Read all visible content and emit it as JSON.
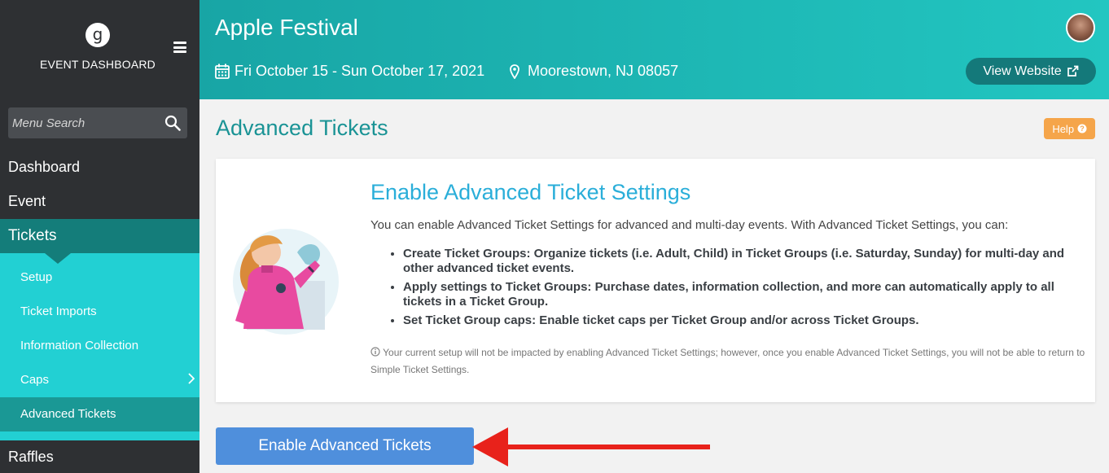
{
  "sidebar": {
    "logo_letter": "g",
    "brand_title": "EVENT DASHBOARD",
    "search_placeholder": "Menu Search",
    "nav": [
      "Dashboard",
      "Event"
    ],
    "section": "Tickets",
    "sub_items": [
      "Setup",
      "Ticket Imports",
      "Information Collection",
      "Caps",
      "Advanced Tickets"
    ],
    "active_sub": "Advanced Tickets",
    "after": "Raffles"
  },
  "header": {
    "event_name": "Apple Festival",
    "dates": "Fri October 15 - Sun October 17, 2021",
    "location": "Moorestown, NJ 08057",
    "view_website": "View Website"
  },
  "main": {
    "page_title": "Advanced Tickets",
    "help_label": "Help",
    "card": {
      "title": "Enable Advanced Ticket Settings",
      "intro": "You can enable Advanced Ticket Settings for advanced and multi-day events. With Advanced Ticket Settings, you can:",
      "bullets": [
        "Create Ticket Groups: Organize tickets (i.e. Adult, Child) in Ticket Groups (i.e. Saturday, Sunday) for multi-day and other advanced ticket events.",
        "Apply settings to Ticket Groups: Purchase dates, information collection, and more can automatically apply to all tickets in a Ticket Group.",
        "Set Ticket Group caps: Enable ticket caps per Ticket Group and/or across Ticket Groups."
      ],
      "note": "Your current setup will not be impacted by enabling Advanced Ticket Settings; however, once you enable Advanced Ticket Settings, you will not be able to return to Simple Ticket Settings."
    },
    "enable_button": "Enable Advanced Tickets"
  },
  "colors": {
    "sidebar_bg": "#2e3033",
    "submenu_bg": "#22d0d3",
    "header_teal": "#1fb8b5",
    "title_teal": "#1a9395",
    "card_title_blue": "#2aaed9",
    "help_orange": "#f5a54a",
    "enable_blue": "#4f8fdc",
    "arrow_red": "#e8221b"
  },
  "icons": [
    "search-icon",
    "hamburger-icon",
    "calendar-icon",
    "map-pin-icon",
    "external-link-icon",
    "question-circle-icon",
    "info-circle-icon",
    "chevron-right-icon"
  ]
}
